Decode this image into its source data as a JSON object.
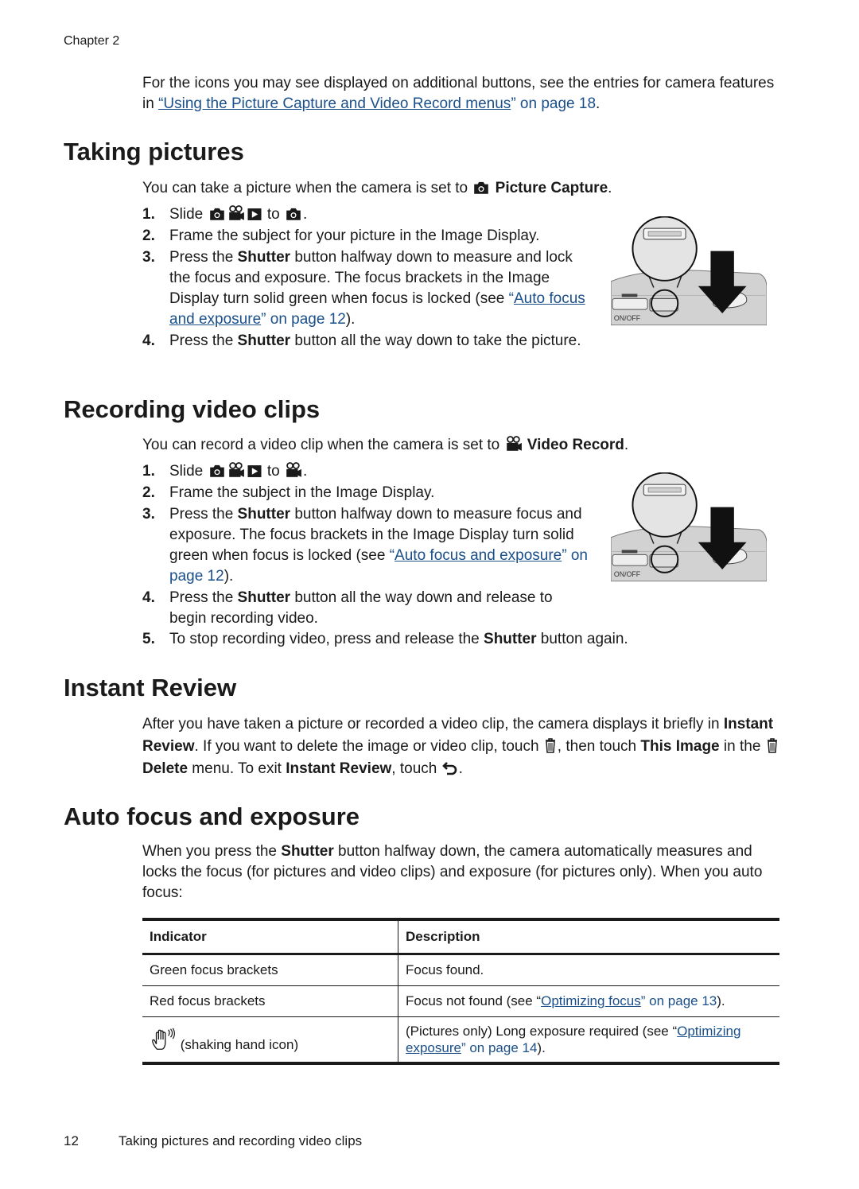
{
  "header": {
    "running_head": "Chapter 2"
  },
  "intro": {
    "text_before": "For the icons you may see displayed on additional buttons, see the entries for camera features in ",
    "link_text": "“Using the Picture Capture and Video Record menus",
    "link_tail": "” on page 18",
    "text_after": "."
  },
  "taking_pictures": {
    "heading": "Taking pictures",
    "lead_before": "You can take a picture when the camera is set to ",
    "lead_bold": "Picture Capture",
    "lead_after": ".",
    "steps": [
      {
        "num": "1.",
        "before": "Slide",
        "to": "to",
        "after": "."
      },
      {
        "num": "2.",
        "text": "Frame the subject for your picture in the Image Display."
      },
      {
        "num": "3.",
        "before": "Press the ",
        "bold": "Shutter",
        "after": " button halfway down to measure and lock the focus and exposure. The focus brackets in the Image Display turn solid green when focus is locked (see ",
        "link_open": "“",
        "link_text": "Auto focus and exposure",
        "link_tail": "” on page 12",
        "end": ")."
      },
      {
        "num": "4.",
        "before": "Press the ",
        "bold": "Shutter",
        "after": " button all the way down to take the picture."
      }
    ],
    "figure": {
      "label": "ON/OFF",
      "icon": "camera-mode-slider-illustration"
    }
  },
  "recording_video": {
    "heading": "Recording video clips",
    "lead_before": "You can record a video clip when the camera is set to ",
    "lead_bold": "Video Record",
    "lead_after": ".",
    "steps": [
      {
        "num": "1.",
        "before": "Slide",
        "to": "to",
        "after": "."
      },
      {
        "num": "2.",
        "text": "Frame the subject in the Image Display."
      },
      {
        "num": "3.",
        "before": "Press the ",
        "bold": "Shutter",
        "after": " button halfway down to measure focus and exposure. The focus brackets in the Image Display turn solid green when focus is locked (see ",
        "link_open": "“",
        "link_text": "Auto focus and exposure",
        "link_tail": "” on page 12",
        "end": ")."
      },
      {
        "num": "4.",
        "before": "Press the ",
        "bold": "Shutter",
        "after": " button all the way down and release to begin recording video."
      },
      {
        "num": "5.",
        "before": "To stop recording video, press and release the ",
        "bold": "Shutter",
        "after": " button again."
      }
    ],
    "figure": {
      "label": "ON/OFF",
      "icon": "video-mode-slider-illustration"
    }
  },
  "instant_review": {
    "heading": "Instant Review",
    "p1": "After you have taken a picture or recorded a video clip, the camera displays it briefly in ",
    "b1": "Instant Review",
    "p2": ". If you want to delete the image or video clip, touch ",
    "p3": ", then touch ",
    "b2": "This Image",
    "p4": " in the ",
    "b3": "Delete",
    "p5": " menu. To exit ",
    "b4": "Instant Review",
    "p6": ", touch ",
    "p7": "."
  },
  "auto_focus": {
    "heading": "Auto focus and exposure",
    "p1": "When you press the ",
    "b1": "Shutter",
    "p2": " button halfway down, the camera automatically measures and locks the focus (for pictures and video clips) and exposure (for pictures only). When you auto focus:",
    "table": {
      "headers": [
        "Indicator",
        "Description"
      ],
      "rows": [
        {
          "indicator": "Green focus brackets",
          "description": "Focus found."
        },
        {
          "indicator": "Red focus brackets",
          "desc_before": "Focus not found (see “",
          "link_text": "Optimizing focus",
          "link_tail": "” on page 13",
          "desc_after": ")."
        },
        {
          "indicator": "(shaking hand icon)",
          "icon": "shaking-hand-icon",
          "desc_before": "(Pictures only) Long exposure required (see “",
          "link_text": "Optimizing exposure",
          "link_tail": "” on page 14",
          "desc_after": ")."
        }
      ]
    }
  },
  "footer": {
    "page_number": "12",
    "section_title": "Taking pictures and recording video clips"
  }
}
